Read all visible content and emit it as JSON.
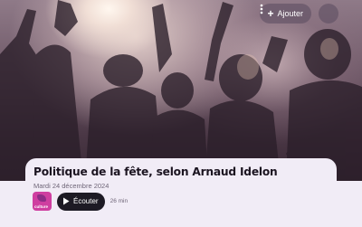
{
  "header": {
    "add_label": "Ajouter",
    "add_icon": "plus-icon",
    "more_icon": "more-vertical-icon"
  },
  "episode": {
    "title": "Politique de la fête, selon Arnaud Idelon",
    "date": "Mardi 24 décembre 2024",
    "station_logo_text": "culture",
    "listen_label": "Écouter",
    "listen_icon": "play-icon",
    "duration": "26 min"
  },
  "colors": {
    "card_background": "#f1ecf6",
    "listen_button": "#1d1a24",
    "station_logo": "#cf3ea0"
  }
}
